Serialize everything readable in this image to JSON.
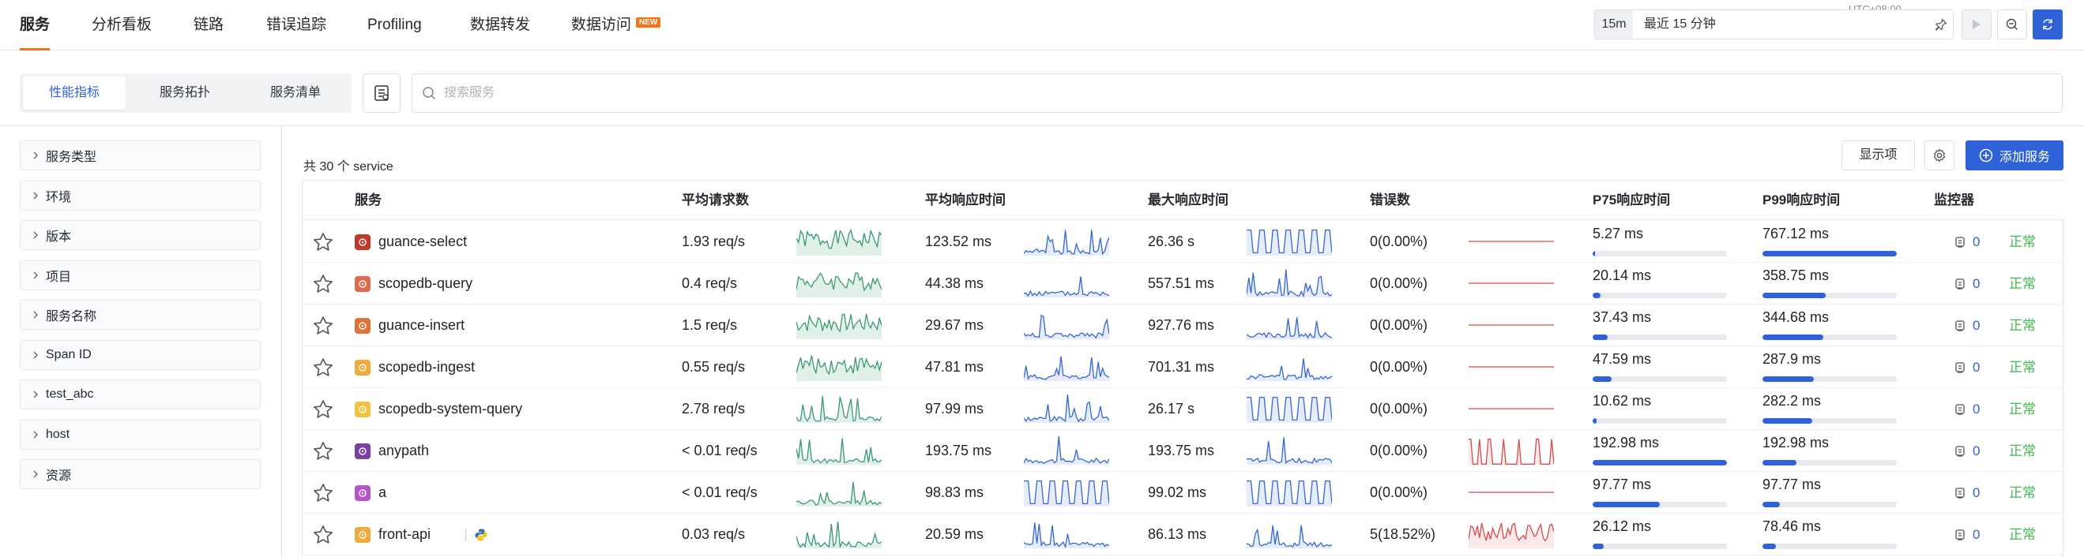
{
  "nav": {
    "tabs": [
      {
        "label": "服务"
      },
      {
        "label": "分析看板"
      },
      {
        "label": "链路"
      },
      {
        "label": "错误追踪"
      },
      {
        "label": "Profiling"
      },
      {
        "label": "数据转发"
      },
      {
        "label": "数据访问"
      }
    ],
    "new_badge": "NEW",
    "timezone": "UTC+08:00",
    "time_quick": "15m",
    "time_range": "最近 15 分钟"
  },
  "subbar": {
    "segments": [
      "性能指标",
      "服务拓扑",
      "服务清单"
    ],
    "search_placeholder": "搜索服务"
  },
  "filters": [
    "服务类型",
    "环境",
    "版本",
    "项目",
    "服务名称",
    "Span ID",
    "test_abc",
    "host",
    "资源"
  ],
  "toolbar": {
    "count": "共 30 个 service",
    "display_btn": "显示项",
    "add_btn": "添加服务"
  },
  "table": {
    "headers": [
      "服务",
      "平均请求数",
      "平均响应时间",
      "最大响应时间",
      "错误数",
      "P75响应时间",
      "P99响应时间",
      "监控器"
    ],
    "rows": [
      {
        "name": "guance-select",
        "icon_color": "#c0392b",
        "req": "1.93 req/s",
        "avg": "123.52 ms",
        "max": "26.36 s",
        "err": "0(0.00%)",
        "p75": "5.27 ms",
        "p75_pct": 0.02,
        "p99": "767.12 ms",
        "p99_pct": 1.0,
        "monitor": "0",
        "status": "正常"
      },
      {
        "name": "scopedb-query",
        "icon_color": "#e06a4f",
        "req": "0.4 req/s",
        "avg": "44.38 ms",
        "max": "557.51 ms",
        "err": "0(0.00%)",
        "p75": "20.14 ms",
        "p75_pct": 0.06,
        "p99": "358.75 ms",
        "p99_pct": 0.47,
        "monitor": "0",
        "status": "正常"
      },
      {
        "name": "guance-insert",
        "icon_color": "#e0713a",
        "req": "1.5 req/s",
        "avg": "29.67 ms",
        "max": "927.76 ms",
        "err": "0(0.00%)",
        "p75": "37.43 ms",
        "p75_pct": 0.11,
        "p99": "344.68 ms",
        "p99_pct": 0.45,
        "monitor": "0",
        "status": "正常"
      },
      {
        "name": "scopedb-ingest",
        "icon_color": "#f0a93b",
        "req": "0.55 req/s",
        "avg": "47.81 ms",
        "max": "701.31 ms",
        "err": "0(0.00%)",
        "p75": "47.59 ms",
        "p75_pct": 0.14,
        "p99": "287.9 ms",
        "p99_pct": 0.38,
        "monitor": "0",
        "status": "正常"
      },
      {
        "name": "scopedb-system-query",
        "icon_color": "#f2c13d",
        "req": "2.78 req/s",
        "avg": "97.99 ms",
        "max": "26.17 s",
        "err": "0(0.00%)",
        "p75": "10.62 ms",
        "p75_pct": 0.03,
        "p99": "282.2 ms",
        "p99_pct": 0.37,
        "monitor": "0",
        "status": "正常"
      },
      {
        "name": "anypath",
        "icon_color": "#7b3fa0",
        "req": "< 0.01 req/s",
        "avg": "193.75 ms",
        "max": "193.75 ms",
        "err": "0(0.00%)",
        "p75": "192.98 ms",
        "p75_pct": 1.0,
        "p99": "192.98 ms",
        "p99_pct": 0.25,
        "monitor": "0",
        "status": "正常"
      },
      {
        "name": "a",
        "icon_color": "#b455c9",
        "req": "< 0.01 req/s",
        "avg": "98.83 ms",
        "max": "99.02 ms",
        "err": "0(0.00%)",
        "p75": "97.77 ms",
        "p75_pct": 0.5,
        "p99": "97.77 ms",
        "p99_pct": 0.13,
        "monitor": "0",
        "status": "正常"
      },
      {
        "name": "front-api",
        "icon_color": "#f0a93b",
        "req": "0.03 req/s",
        "avg": "20.59 ms",
        "max": "86.13 ms",
        "err": "5(18.52%)",
        "p75": "26.12 ms",
        "p75_pct": 0.08,
        "p99": "78.46 ms",
        "p99_pct": 0.1,
        "monitor": "0",
        "status": "正常",
        "lang": "python-icon"
      }
    ]
  },
  "colors": {
    "accent": "#2f62d8",
    "tab_underline": "#f97316",
    "spark_green": "#3a9b6f",
    "spark_blue": "#3566d6",
    "spark_red": "#d94a4a",
    "status_ok": "#3fb950"
  }
}
